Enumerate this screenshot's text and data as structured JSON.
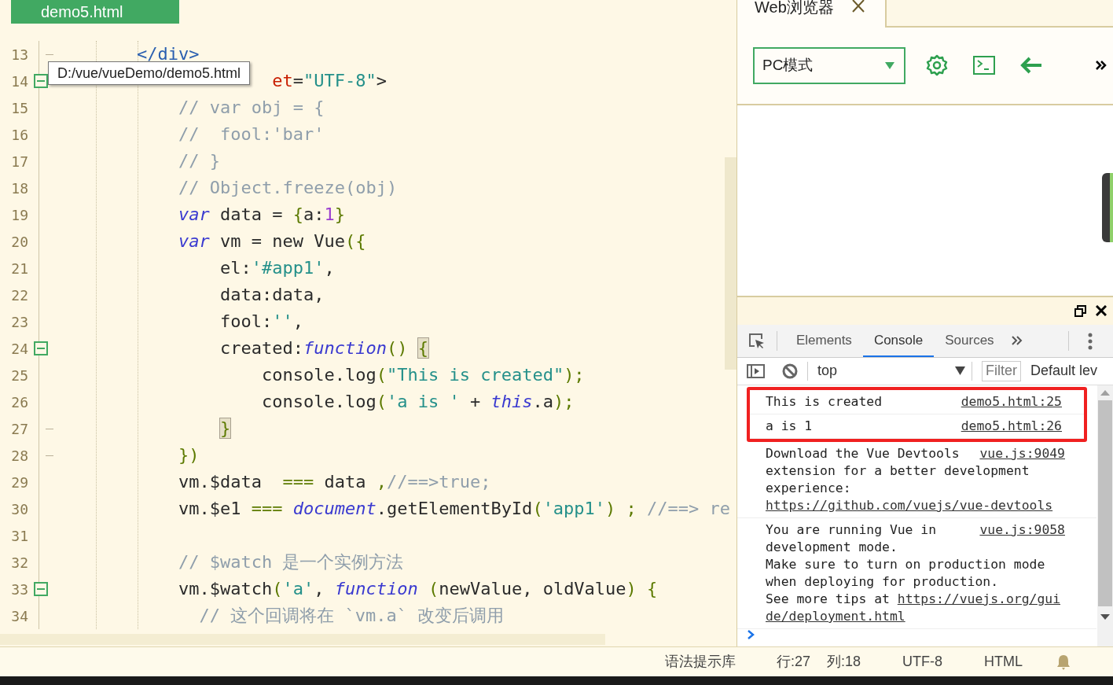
{
  "editor": {
    "tab": {
      "label": "demo5.html",
      "selected": true
    },
    "tooltip": "D:/vue/vueDemo/demo5.html",
    "lines": [
      {
        "number": "13",
        "kind": "fold_end",
        "tokens": [
          {
            "kind": "tag",
            "t": "        </div>"
          }
        ]
      },
      {
        "number": "14",
        "kind": "fold_start",
        "tokens": [
          {
            "kind": "attr",
            "t": "                     et"
          },
          {
            "kind": "plain",
            "t": "="
          },
          {
            "kind": "string",
            "t": "\"UTF-8\""
          },
          {
            "kind": "plain",
            "t": ">"
          }
        ]
      },
      {
        "number": "15",
        "kind": "line",
        "tokens": [
          {
            "kind": "comment",
            "t": "            // var obj = {"
          }
        ]
      },
      {
        "number": "16",
        "kind": "line",
        "tokens": [
          {
            "kind": "comment",
            "t": "            //  fool:'bar'"
          }
        ]
      },
      {
        "number": "17",
        "kind": "line",
        "tokens": [
          {
            "kind": "comment",
            "t": "            // }"
          }
        ]
      },
      {
        "number": "18",
        "kind": "line",
        "tokens": [
          {
            "kind": "comment",
            "t": "            // Object.freeze(obj)"
          }
        ]
      },
      {
        "number": "19",
        "kind": "line",
        "tokens": [
          {
            "kind": "keyword",
            "t": "            var"
          },
          {
            "kind": "plain",
            "t": " data = "
          },
          {
            "kind": "punct",
            "t": "{"
          },
          {
            "kind": "plain",
            "t": "a:"
          },
          {
            "kind": "number",
            "t": "1"
          },
          {
            "kind": "punct",
            "t": "}"
          }
        ]
      },
      {
        "number": "20",
        "kind": "line",
        "tokens": [
          {
            "kind": "keyword",
            "t": "            var"
          },
          {
            "kind": "plain",
            "t": " vm = new Vue"
          },
          {
            "kind": "punct",
            "t": "({"
          }
        ]
      },
      {
        "number": "21",
        "kind": "line",
        "tokens": [
          {
            "kind": "plain",
            "t": "                el:"
          },
          {
            "kind": "string",
            "t": "'#app1'"
          },
          {
            "kind": "plain",
            "t": ","
          }
        ]
      },
      {
        "number": "22",
        "kind": "line",
        "tokens": [
          {
            "kind": "plain",
            "t": "                data:data,"
          }
        ]
      },
      {
        "number": "23",
        "kind": "line",
        "tokens": [
          {
            "kind": "plain",
            "t": "                fool:"
          },
          {
            "kind": "string",
            "t": "''"
          },
          {
            "kind": "plain",
            "t": ","
          }
        ]
      },
      {
        "number": "24",
        "kind": "fold_start",
        "tokens": [
          {
            "kind": "plain",
            "t": "                created:"
          },
          {
            "kind": "keyword",
            "t": "function"
          },
          {
            "kind": "punct",
            "t": "() "
          },
          {
            "kind": "match",
            "t": "{"
          }
        ]
      },
      {
        "number": "25",
        "kind": "line",
        "tokens": [
          {
            "kind": "plain",
            "t": "                    console.log"
          },
          {
            "kind": "punct",
            "t": "("
          },
          {
            "kind": "string",
            "t": "\"This is created\""
          },
          {
            "kind": "punct",
            "t": ");"
          }
        ]
      },
      {
        "number": "26",
        "kind": "line",
        "tokens": [
          {
            "kind": "plain",
            "t": "                    console.log"
          },
          {
            "kind": "punct",
            "t": "("
          },
          {
            "kind": "string",
            "t": "'a is '"
          },
          {
            "kind": "plain",
            "t": " + "
          },
          {
            "kind": "keyword",
            "t": "this"
          },
          {
            "kind": "plain",
            "t": ".a"
          },
          {
            "kind": "punct",
            "t": ");"
          }
        ]
      },
      {
        "number": "27",
        "kind": "fold_end",
        "tokens": [
          {
            "kind": "match",
            "t": "                }"
          }
        ]
      },
      {
        "number": "28",
        "kind": "fold_end",
        "tokens": [
          {
            "kind": "punct",
            "t": "            })"
          }
        ]
      },
      {
        "number": "29",
        "kind": "line",
        "tokens": [
          {
            "kind": "plain",
            "t": "            vm.$data  "
          },
          {
            "kind": "punct",
            "t": "==="
          },
          {
            "kind": "plain",
            "t": " data "
          },
          {
            "kind": "punct",
            "t": ","
          },
          {
            "kind": "comment",
            "t": "//==>true;"
          }
        ]
      },
      {
        "number": "30",
        "kind": "line",
        "tokens": [
          {
            "kind": "plain",
            "t": "            vm.$e1 "
          },
          {
            "kind": "punct",
            "t": "==="
          },
          {
            "kind": "keyword",
            "t": " document"
          },
          {
            "kind": "plain",
            "t": ".getElementById"
          },
          {
            "kind": "punct",
            "t": "("
          },
          {
            "kind": "string",
            "t": "'app1'"
          },
          {
            "kind": "punct",
            "t": ") ; "
          },
          {
            "kind": "comment",
            "t": "//==> re"
          }
        ]
      },
      {
        "number": "31",
        "kind": "line"
      },
      {
        "number": "32",
        "kind": "line",
        "tokens": [
          {
            "kind": "comment",
            "t": "            // $watch 是一个实例方法"
          }
        ]
      },
      {
        "number": "33",
        "kind": "fold_start",
        "tokens": [
          {
            "kind": "plain",
            "t": "            vm.$watch"
          },
          {
            "kind": "punct",
            "t": "("
          },
          {
            "kind": "string",
            "t": "'a'"
          },
          {
            "kind": "plain",
            "t": ", "
          },
          {
            "kind": "keyword",
            "t": "function"
          },
          {
            "kind": "punct",
            "t": " ("
          },
          {
            "kind": "plain",
            "t": "newValue, oldValue"
          },
          {
            "kind": "punct",
            "t": ") {"
          }
        ]
      },
      {
        "number": "34",
        "kind": "line",
        "tokens": [
          {
            "kind": "comment",
            "t": "              // 这个回调将在 `vm.a` 改变后调用"
          }
        ]
      }
    ]
  },
  "browser": {
    "tab": {
      "label": "Web浏览器",
      "selected": true
    },
    "mode_select": {
      "value": "PC模式"
    }
  },
  "devtools": {
    "tabs": [
      {
        "label": "Elements",
        "selected": false
      },
      {
        "label": "Console",
        "selected": true
      },
      {
        "label": "Sources",
        "selected": false
      }
    ],
    "context": "top",
    "filter": {
      "placeholder": "Filter"
    },
    "levels": "Default lev",
    "marked_messages": [
      {
        "lines": [
          [
            {
              "text": "This is created"
            }
          ]
        ],
        "source": "demo5.html:25"
      },
      {
        "lines": [
          [
            {
              "text": "a is 1"
            }
          ]
        ],
        "source": "demo5.html:26"
      }
    ],
    "messages": [
      {
        "lines": [
          [
            {
              "text": "Download the Vue Devtools"
            }
          ],
          [
            {
              "text": "extension for a better development"
            }
          ],
          [
            {
              "text": "experience:"
            }
          ],
          [
            {
              "link": "https://github.com/vuejs/vue-devtools"
            }
          ]
        ],
        "source": "vue.js:9049"
      },
      {
        "lines": [
          [
            {
              "text": "You are running Vue in"
            }
          ],
          [
            {
              "text": "development mode."
            }
          ],
          [
            {
              "text": "Make sure to turn on production mode"
            }
          ],
          [
            {
              "text": "when deploying for production."
            }
          ],
          [
            {
              "text": "See more tips at "
            },
            {
              "link": "https://vuejs.org/gui"
            }
          ],
          [
            {
              "link": "de/deployment.html"
            }
          ]
        ],
        "source": "vue.js:9058"
      }
    ]
  },
  "status_bar": [
    "语法提示库",
    "行:27",
    "列:18",
    "UTF-8",
    "HTML"
  ]
}
